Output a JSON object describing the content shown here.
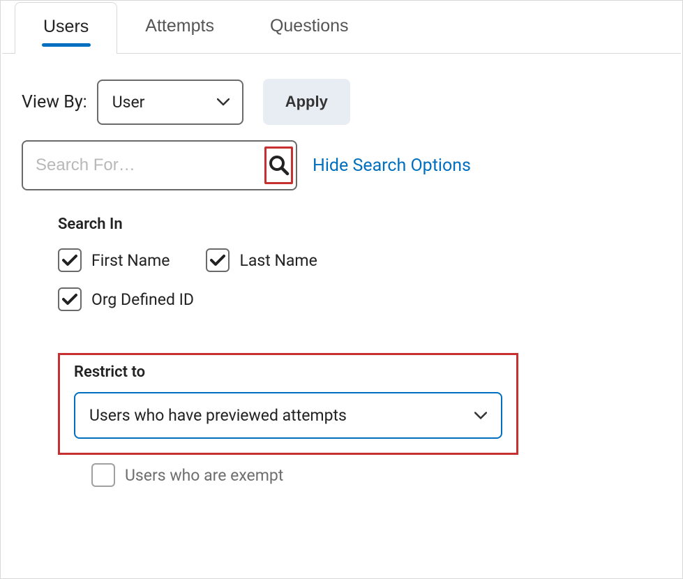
{
  "tabs": {
    "users": "Users",
    "attempts": "Attempts",
    "questions": "Questions"
  },
  "viewby": {
    "label": "View By:",
    "selected": "User",
    "apply": "Apply"
  },
  "search": {
    "placeholder": "Search For…",
    "hide_link": "Hide Search Options"
  },
  "searchin": {
    "title": "Search In",
    "first_name": "First Name",
    "last_name": "Last Name",
    "org_id": "Org Defined ID"
  },
  "restrict": {
    "title": "Restrict to",
    "selected": "Users who have previewed attempts",
    "exempt": "Users who are exempt"
  }
}
